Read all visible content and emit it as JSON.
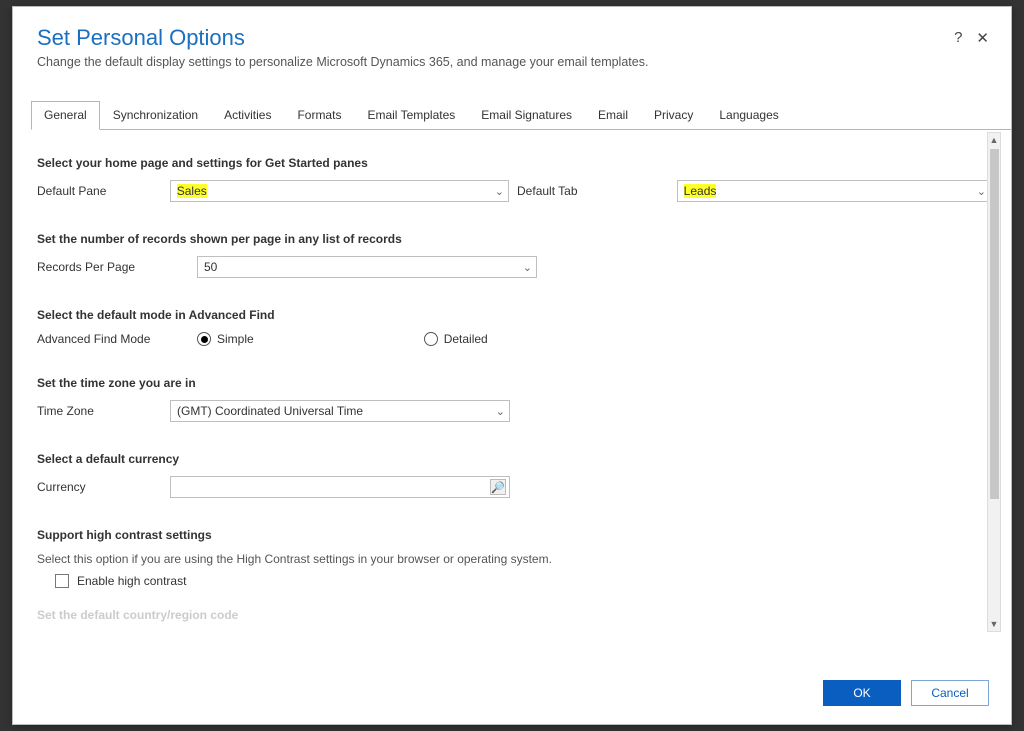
{
  "dialog": {
    "title": "Set Personal Options",
    "subtitle": "Change the default display settings to personalize Microsoft Dynamics 365, and manage your email templates.",
    "help_tip": "?",
    "close_tip": "✕"
  },
  "tabs": [
    "General",
    "Synchronization",
    "Activities",
    "Formats",
    "Email Templates",
    "Email Signatures",
    "Email",
    "Privacy",
    "Languages"
  ],
  "tabs_active_index": 0,
  "section1": {
    "title": "Select your home page and settings for Get Started panes",
    "default_pane_label": "Default Pane",
    "default_pane_value": "Sales",
    "default_tab_label": "Default Tab",
    "default_tab_value": "Leads"
  },
  "section2": {
    "title": "Set the number of records shown per page in any list of records",
    "records_label": "Records Per Page",
    "records_value": "50"
  },
  "section3": {
    "title": "Select the default mode in Advanced Find",
    "mode_label": "Advanced Find Mode",
    "simple_label": "Simple",
    "detailed_label": "Detailed"
  },
  "section4": {
    "title": "Set the time zone you are in",
    "tz_label": "Time Zone",
    "tz_value": "(GMT) Coordinated Universal Time"
  },
  "section5": {
    "title": "Select a default currency",
    "currency_label": "Currency"
  },
  "section6": {
    "title": "Support high contrast settings",
    "desc": "Select this option if you are using the High Contrast settings in your browser or operating system.",
    "checkbox_label": "Enable high contrast"
  },
  "cutoff_title": "Set the default country/region code",
  "footer": {
    "ok": "OK",
    "cancel": "Cancel"
  }
}
